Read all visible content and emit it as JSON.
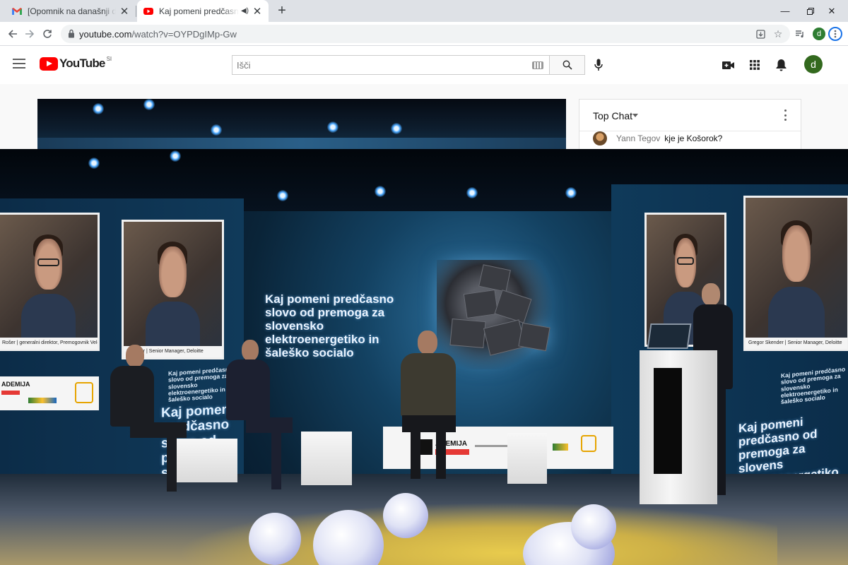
{
  "browser": {
    "tabs": [
      {
        "title": "[Opomnik na današnji digitalni d",
        "favicon": "gmail-icon",
        "active": false
      },
      {
        "title": "Kaj pomeni predčasno slovo",
        "favicon": "youtube-icon",
        "active": true,
        "audio": "speaker-icon"
      }
    ],
    "url_host": "youtube.com",
    "url_path": "/watch?v=OYPDgIMp-Gw",
    "profile_letter": "d"
  },
  "youtube": {
    "logo_text": "YouTube",
    "country_code": "SI",
    "search_placeholder": "Išči",
    "avatar_letter": "d"
  },
  "chat": {
    "title": "Top Chat",
    "messages": [
      {
        "author": "Yann Tegov",
        "text": "kje je Košorok?"
      }
    ]
  },
  "video": {
    "wall_title_main": "Kaj pomeni predčasno slovo od premoga za slovensko elektroenergetiko in šaleško socialo",
    "wall_title_left": "Kaj pomeni predčasno slovo od premoga za slovensko elektroenergetiko in šaleško socialo",
    "wall_title_right": "Kaj pomeni predčasno od premoga za slovens elektroenergetiko in ša socialo",
    "left_small_text": "Kaj pomeni predčasno slovo od premoga za slovensko elektroenergetiko in šaleško socialo",
    "right_small_text": "Kaj pomeni predčasno slovo od premoga za slovensko elektroenergetiko in šaleško socialo",
    "screen_caption_1": "Rošer | generalni direktor, Premogovnik Velenje",
    "screen_caption_2": "Skender | Senior Manager, Deloitte",
    "screen_caption_3": "Gregor Skender | Senior Manager, Deloitte",
    "sponsor_text": "ADEMIJA"
  },
  "colors": {
    "youtube_red": "#ff0000",
    "avatar_green": "#33691e",
    "chrome_tabstrip": "#dee1e6"
  }
}
